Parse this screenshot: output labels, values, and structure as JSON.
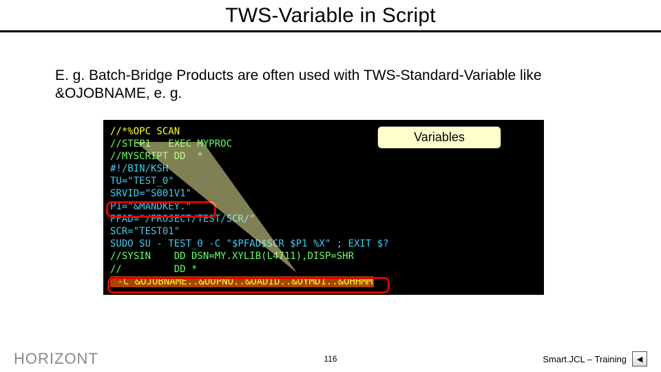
{
  "title": "TWS-Variable in Script",
  "intro": "E. g. Batch-Bridge Products are often used with TWS-Standard-Variable like &OJOBNAME, e. g.",
  "callout_label": "Variables",
  "code": {
    "l1": "//*%OPC SCAN",
    "l2": "//STEP1   EXEC MYPROC",
    "l3": "//MYSCRIPT DD  *",
    "l4": "#!/BIN/KSH",
    "l5": "TU=\"TEST_0\"",
    "l6": "SRVID=\"S001V1\"",
    "l7": "P1=\"&MANDKEY.\"",
    "l8": "PFAD=\"/PROJECT/TEST/SCR/\"",
    "l9": "SCR=\"TEST01\"",
    "l10": "SUDO SU - TEST_0 -C \"$PFAD$SCR $P1 %X\" ; EXIT $?",
    "l11": "//SYSIN    DD DSN=MY.XYLIB(L4711),DISP=SHR",
    "l12": "//         DD *",
    "l13": " -C &OJOBNAME..&OOPNO..&OADID..&OYMD1..&OHHMM"
  },
  "footer": {
    "left": "HORIZONT",
    "page": "116",
    "right": "Smart.JCL – Training",
    "back_glyph": "◄"
  }
}
